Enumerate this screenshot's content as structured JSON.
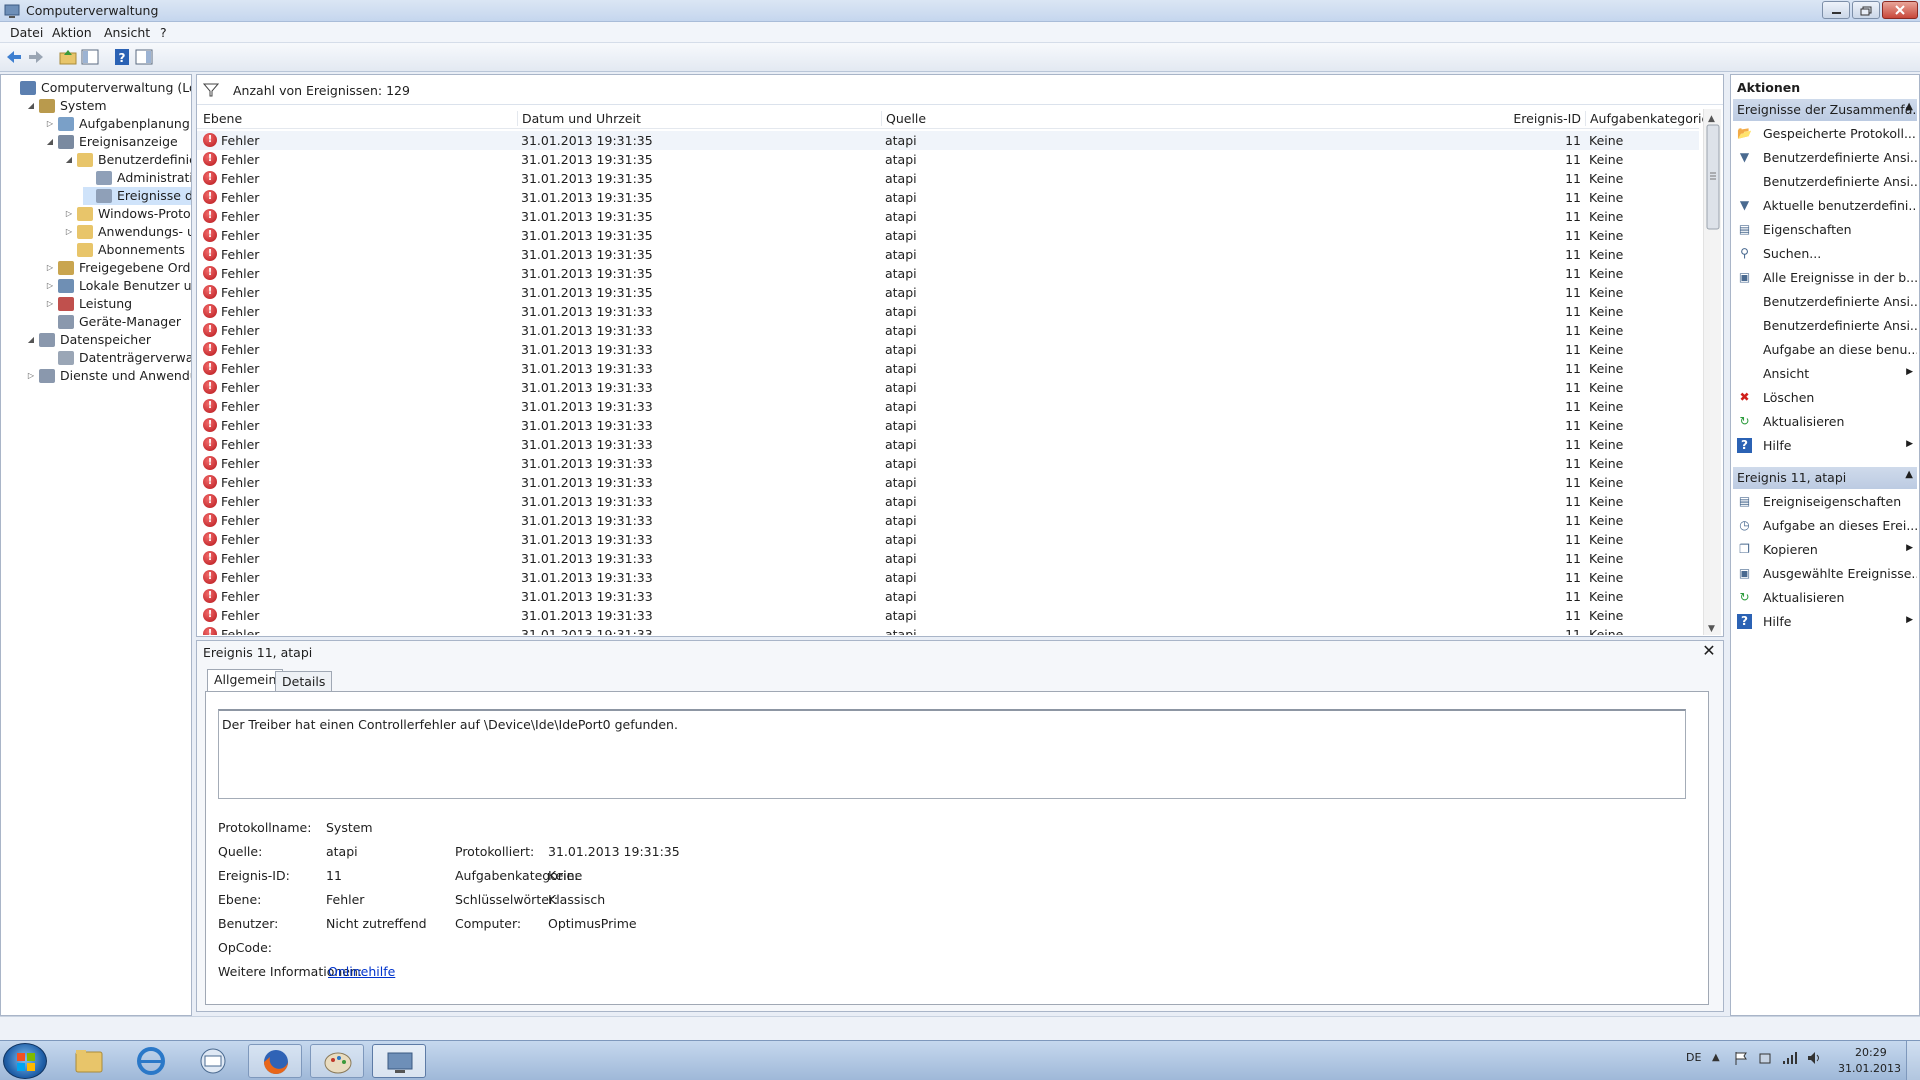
{
  "window": {
    "title": "Computerverwaltung"
  },
  "menu": [
    "Datei",
    "Aktion",
    "Ansicht",
    "?"
  ],
  "tree": [
    {
      "label": "Computerverwaltung (Lokal)",
      "level": 0,
      "expander": "",
      "icon": "computer-icon",
      "color": "#5b7fb0"
    },
    {
      "label": "System",
      "level": 1,
      "expander": "◢",
      "icon": "tools-icon",
      "color": "#b99a4d"
    },
    {
      "label": "Aufgabenplanung",
      "level": 2,
      "expander": "▷",
      "icon": "clock-icon",
      "color": "#7aa0c8"
    },
    {
      "label": "Ereignisanzeige",
      "level": 2,
      "expander": "◢",
      "icon": "event-viewer-icon",
      "color": "#7a8aa0"
    },
    {
      "label": "Benutzerdefinierte A",
      "level": 3,
      "expander": "◢",
      "icon": "folder-icon",
      "color": "#e8c56a"
    },
    {
      "label": "Administrative E",
      "level": 4,
      "expander": "",
      "icon": "filter-icon",
      "color": "#8fa0b8"
    },
    {
      "label": "Ereignisse der Zu",
      "level": 4,
      "expander": "",
      "icon": "filter-icon",
      "color": "#8fa0b8",
      "selected": true
    },
    {
      "label": "Windows-Protokolle",
      "level": 3,
      "expander": "▷",
      "icon": "folder-icon",
      "color": "#e8c56a"
    },
    {
      "label": "Anwendungs- und D",
      "level": 3,
      "expander": "▷",
      "icon": "folder-icon",
      "color": "#e8c56a"
    },
    {
      "label": "Abonnements",
      "level": 3,
      "expander": "",
      "icon": "subscriptions-icon",
      "color": "#e8c56a"
    },
    {
      "label": "Freigegebene Ordner",
      "level": 2,
      "expander": "▷",
      "icon": "shared-folder-icon",
      "color": "#c9a54f"
    },
    {
      "label": "Lokale Benutzer und Gr",
      "level": 2,
      "expander": "▷",
      "icon": "users-icon",
      "color": "#6f8fb4"
    },
    {
      "label": "Leistung",
      "level": 2,
      "expander": "▷",
      "icon": "performance-icon",
      "color": "#c0504d"
    },
    {
      "label": "Geräte-Manager",
      "level": 2,
      "expander": "",
      "icon": "device-manager-icon",
      "color": "#8a98ad"
    },
    {
      "label": "Datenspeicher",
      "level": 1,
      "expander": "◢",
      "icon": "storage-icon",
      "color": "#8a98ad"
    },
    {
      "label": "Datenträgerverwaltung",
      "level": 2,
      "expander": "",
      "icon": "disk-icon",
      "color": "#9aa6b6"
    },
    {
      "label": "Dienste und Anwendungen",
      "level": 1,
      "expander": "▷",
      "icon": "services-icon",
      "color": "#8a98ad"
    }
  ],
  "events": {
    "count_label": "Anzahl von Ereignissen: 129",
    "columns": {
      "level": "Ebene",
      "datetime": "Datum und Uhrzeit",
      "source": "Quelle",
      "event_id": "Ereignis-ID",
      "category": "Aufgabenkategorie"
    },
    "rows": [
      {
        "level": "Fehler",
        "datetime": "31.01.2013 19:31:35",
        "source": "atapi",
        "event_id": "11",
        "category": "Keine"
      },
      {
        "level": "Fehler",
        "datetime": "31.01.2013 19:31:35",
        "source": "atapi",
        "event_id": "11",
        "category": "Keine"
      },
      {
        "level": "Fehler",
        "datetime": "31.01.2013 19:31:35",
        "source": "atapi",
        "event_id": "11",
        "category": "Keine"
      },
      {
        "level": "Fehler",
        "datetime": "31.01.2013 19:31:35",
        "source": "atapi",
        "event_id": "11",
        "category": "Keine"
      },
      {
        "level": "Fehler",
        "datetime": "31.01.2013 19:31:35",
        "source": "atapi",
        "event_id": "11",
        "category": "Keine"
      },
      {
        "level": "Fehler",
        "datetime": "31.01.2013 19:31:35",
        "source": "atapi",
        "event_id": "11",
        "category": "Keine"
      },
      {
        "level": "Fehler",
        "datetime": "31.01.2013 19:31:35",
        "source": "atapi",
        "event_id": "11",
        "category": "Keine"
      },
      {
        "level": "Fehler",
        "datetime": "31.01.2013 19:31:35",
        "source": "atapi",
        "event_id": "11",
        "category": "Keine"
      },
      {
        "level": "Fehler",
        "datetime": "31.01.2013 19:31:35",
        "source": "atapi",
        "event_id": "11",
        "category": "Keine"
      },
      {
        "level": "Fehler",
        "datetime": "31.01.2013 19:31:33",
        "source": "atapi",
        "event_id": "11",
        "category": "Keine"
      },
      {
        "level": "Fehler",
        "datetime": "31.01.2013 19:31:33",
        "source": "atapi",
        "event_id": "11",
        "category": "Keine"
      },
      {
        "level": "Fehler",
        "datetime": "31.01.2013 19:31:33",
        "source": "atapi",
        "event_id": "11",
        "category": "Keine"
      },
      {
        "level": "Fehler",
        "datetime": "31.01.2013 19:31:33",
        "source": "atapi",
        "event_id": "11",
        "category": "Keine"
      },
      {
        "level": "Fehler",
        "datetime": "31.01.2013 19:31:33",
        "source": "atapi",
        "event_id": "11",
        "category": "Keine"
      },
      {
        "level": "Fehler",
        "datetime": "31.01.2013 19:31:33",
        "source": "atapi",
        "event_id": "11",
        "category": "Keine"
      },
      {
        "level": "Fehler",
        "datetime": "31.01.2013 19:31:33",
        "source": "atapi",
        "event_id": "11",
        "category": "Keine"
      },
      {
        "level": "Fehler",
        "datetime": "31.01.2013 19:31:33",
        "source": "atapi",
        "event_id": "11",
        "category": "Keine"
      },
      {
        "level": "Fehler",
        "datetime": "31.01.2013 19:31:33",
        "source": "atapi",
        "event_id": "11",
        "category": "Keine"
      },
      {
        "level": "Fehler",
        "datetime": "31.01.2013 19:31:33",
        "source": "atapi",
        "event_id": "11",
        "category": "Keine"
      },
      {
        "level": "Fehler",
        "datetime": "31.01.2013 19:31:33",
        "source": "atapi",
        "event_id": "11",
        "category": "Keine"
      },
      {
        "level": "Fehler",
        "datetime": "31.01.2013 19:31:33",
        "source": "atapi",
        "event_id": "11",
        "category": "Keine"
      },
      {
        "level": "Fehler",
        "datetime": "31.01.2013 19:31:33",
        "source": "atapi",
        "event_id": "11",
        "category": "Keine"
      },
      {
        "level": "Fehler",
        "datetime": "31.01.2013 19:31:33",
        "source": "atapi",
        "event_id": "11",
        "category": "Keine"
      },
      {
        "level": "Fehler",
        "datetime": "31.01.2013 19:31:33",
        "source": "atapi",
        "event_id": "11",
        "category": "Keine"
      },
      {
        "level": "Fehler",
        "datetime": "31.01.2013 19:31:33",
        "source": "atapi",
        "event_id": "11",
        "category": "Keine"
      },
      {
        "level": "Fehler",
        "datetime": "31.01.2013 19:31:33",
        "source": "atapi",
        "event_id": "11",
        "category": "Keine"
      },
      {
        "level": "Fehler",
        "datetime": "31.01.2013 19:31:33",
        "source": "atapi",
        "event_id": "11",
        "category": "Keine"
      }
    ]
  },
  "detail": {
    "title": "Ereignis 11, atapi",
    "tabs": [
      "Allgemein",
      "Details"
    ],
    "message": "Der Treiber hat einen Controllerfehler auf \\Device\\Ide\\IdePort0 gefunden.",
    "log_name_label": "Protokollname:",
    "log_name": "System",
    "source_label": "Quelle:",
    "source": "atapi",
    "logged_label": "Protokolliert:",
    "logged": "31.01.2013 19:31:35",
    "event_id_label": "Ereignis-ID:",
    "event_id": "11",
    "category_label": "Aufgabenkategorie:",
    "category": "Keine",
    "level_label": "Ebene:",
    "level": "Fehler",
    "keywords_label": "Schlüsselwörter:",
    "keywords": "Klassisch",
    "user_label": "Benutzer:",
    "user": "Nicht zutreffend",
    "computer_label": "Computer:",
    "computer": "OptimusPrime",
    "opcode_label": "OpCode:",
    "more_info_label": "Weitere Informationen:",
    "more_info_link": "Onlinehilfe"
  },
  "actions": {
    "title": "Aktionen",
    "section1": "Ereignisse der Zusammenfa...",
    "items1": [
      {
        "label": "Gespeicherte Protokoll...",
        "icon": "folder-open-icon",
        "glyph": "📂",
        "sub": false
      },
      {
        "label": "Benutzerdefinierte Ansi...",
        "icon": "filter-icon",
        "glyph": "▼",
        "sub": false
      },
      {
        "label": "Benutzerdefinierte Ansi...",
        "icon": "",
        "glyph": "",
        "sub": false
      },
      {
        "label": "Aktuelle benutzerdefini...",
        "icon": "filter-icon",
        "glyph": "▼",
        "sub": false
      },
      {
        "label": "Eigenschaften",
        "icon": "properties-icon",
        "glyph": "▤",
        "sub": false
      },
      {
        "label": "Suchen...",
        "icon": "binoculars-icon",
        "glyph": "⚲",
        "sub": false
      },
      {
        "label": "Alle Ereignisse in der b...",
        "icon": "save-icon",
        "glyph": "▣",
        "sub": false
      },
      {
        "label": "Benutzerdefinierte Ansi...",
        "icon": "",
        "glyph": "",
        "sub": false
      },
      {
        "label": "Benutzerdefinierte Ansi...",
        "icon": "",
        "glyph": "",
        "sub": false
      },
      {
        "label": "Aufgabe an diese benu...",
        "icon": "",
        "glyph": "",
        "sub": false
      },
      {
        "label": "Ansicht",
        "icon": "",
        "glyph": "",
        "sub": true
      },
      {
        "label": "Löschen",
        "icon": "delete-icon",
        "glyph": "✖",
        "sub": false
      },
      {
        "label": "Aktualisieren",
        "icon": "refresh-icon",
        "glyph": "↻",
        "sub": false
      },
      {
        "label": "Hilfe",
        "icon": "help-icon",
        "glyph": "?",
        "sub": true
      }
    ],
    "section2": "Ereignis 11, atapi",
    "items2": [
      {
        "label": "Ereigniseigenschaften",
        "icon": "properties-icon",
        "glyph": "▤",
        "sub": false
      },
      {
        "label": "Aufgabe an dieses Erei...",
        "icon": "task-icon",
        "glyph": "◷",
        "sub": false
      },
      {
        "label": "Kopieren",
        "icon": "copy-icon",
        "glyph": "❐",
        "sub": true
      },
      {
        "label": "Ausgewählte Ereignisse...",
        "icon": "save-icon",
        "glyph": "▣",
        "sub": false
      },
      {
        "label": "Aktualisieren",
        "icon": "refresh-icon",
        "glyph": "↻",
        "sub": false
      },
      {
        "label": "Hilfe",
        "icon": "help-icon",
        "glyph": "?",
        "sub": true
      }
    ]
  },
  "taskbar": {
    "language": "DE",
    "time": "20:29",
    "date": "31.01.2013"
  },
  "colors": {
    "error": "#c21a1f",
    "selection": "#cfe3fa",
    "link": "#0033cc",
    "section_header": "#c3d1e6"
  }
}
